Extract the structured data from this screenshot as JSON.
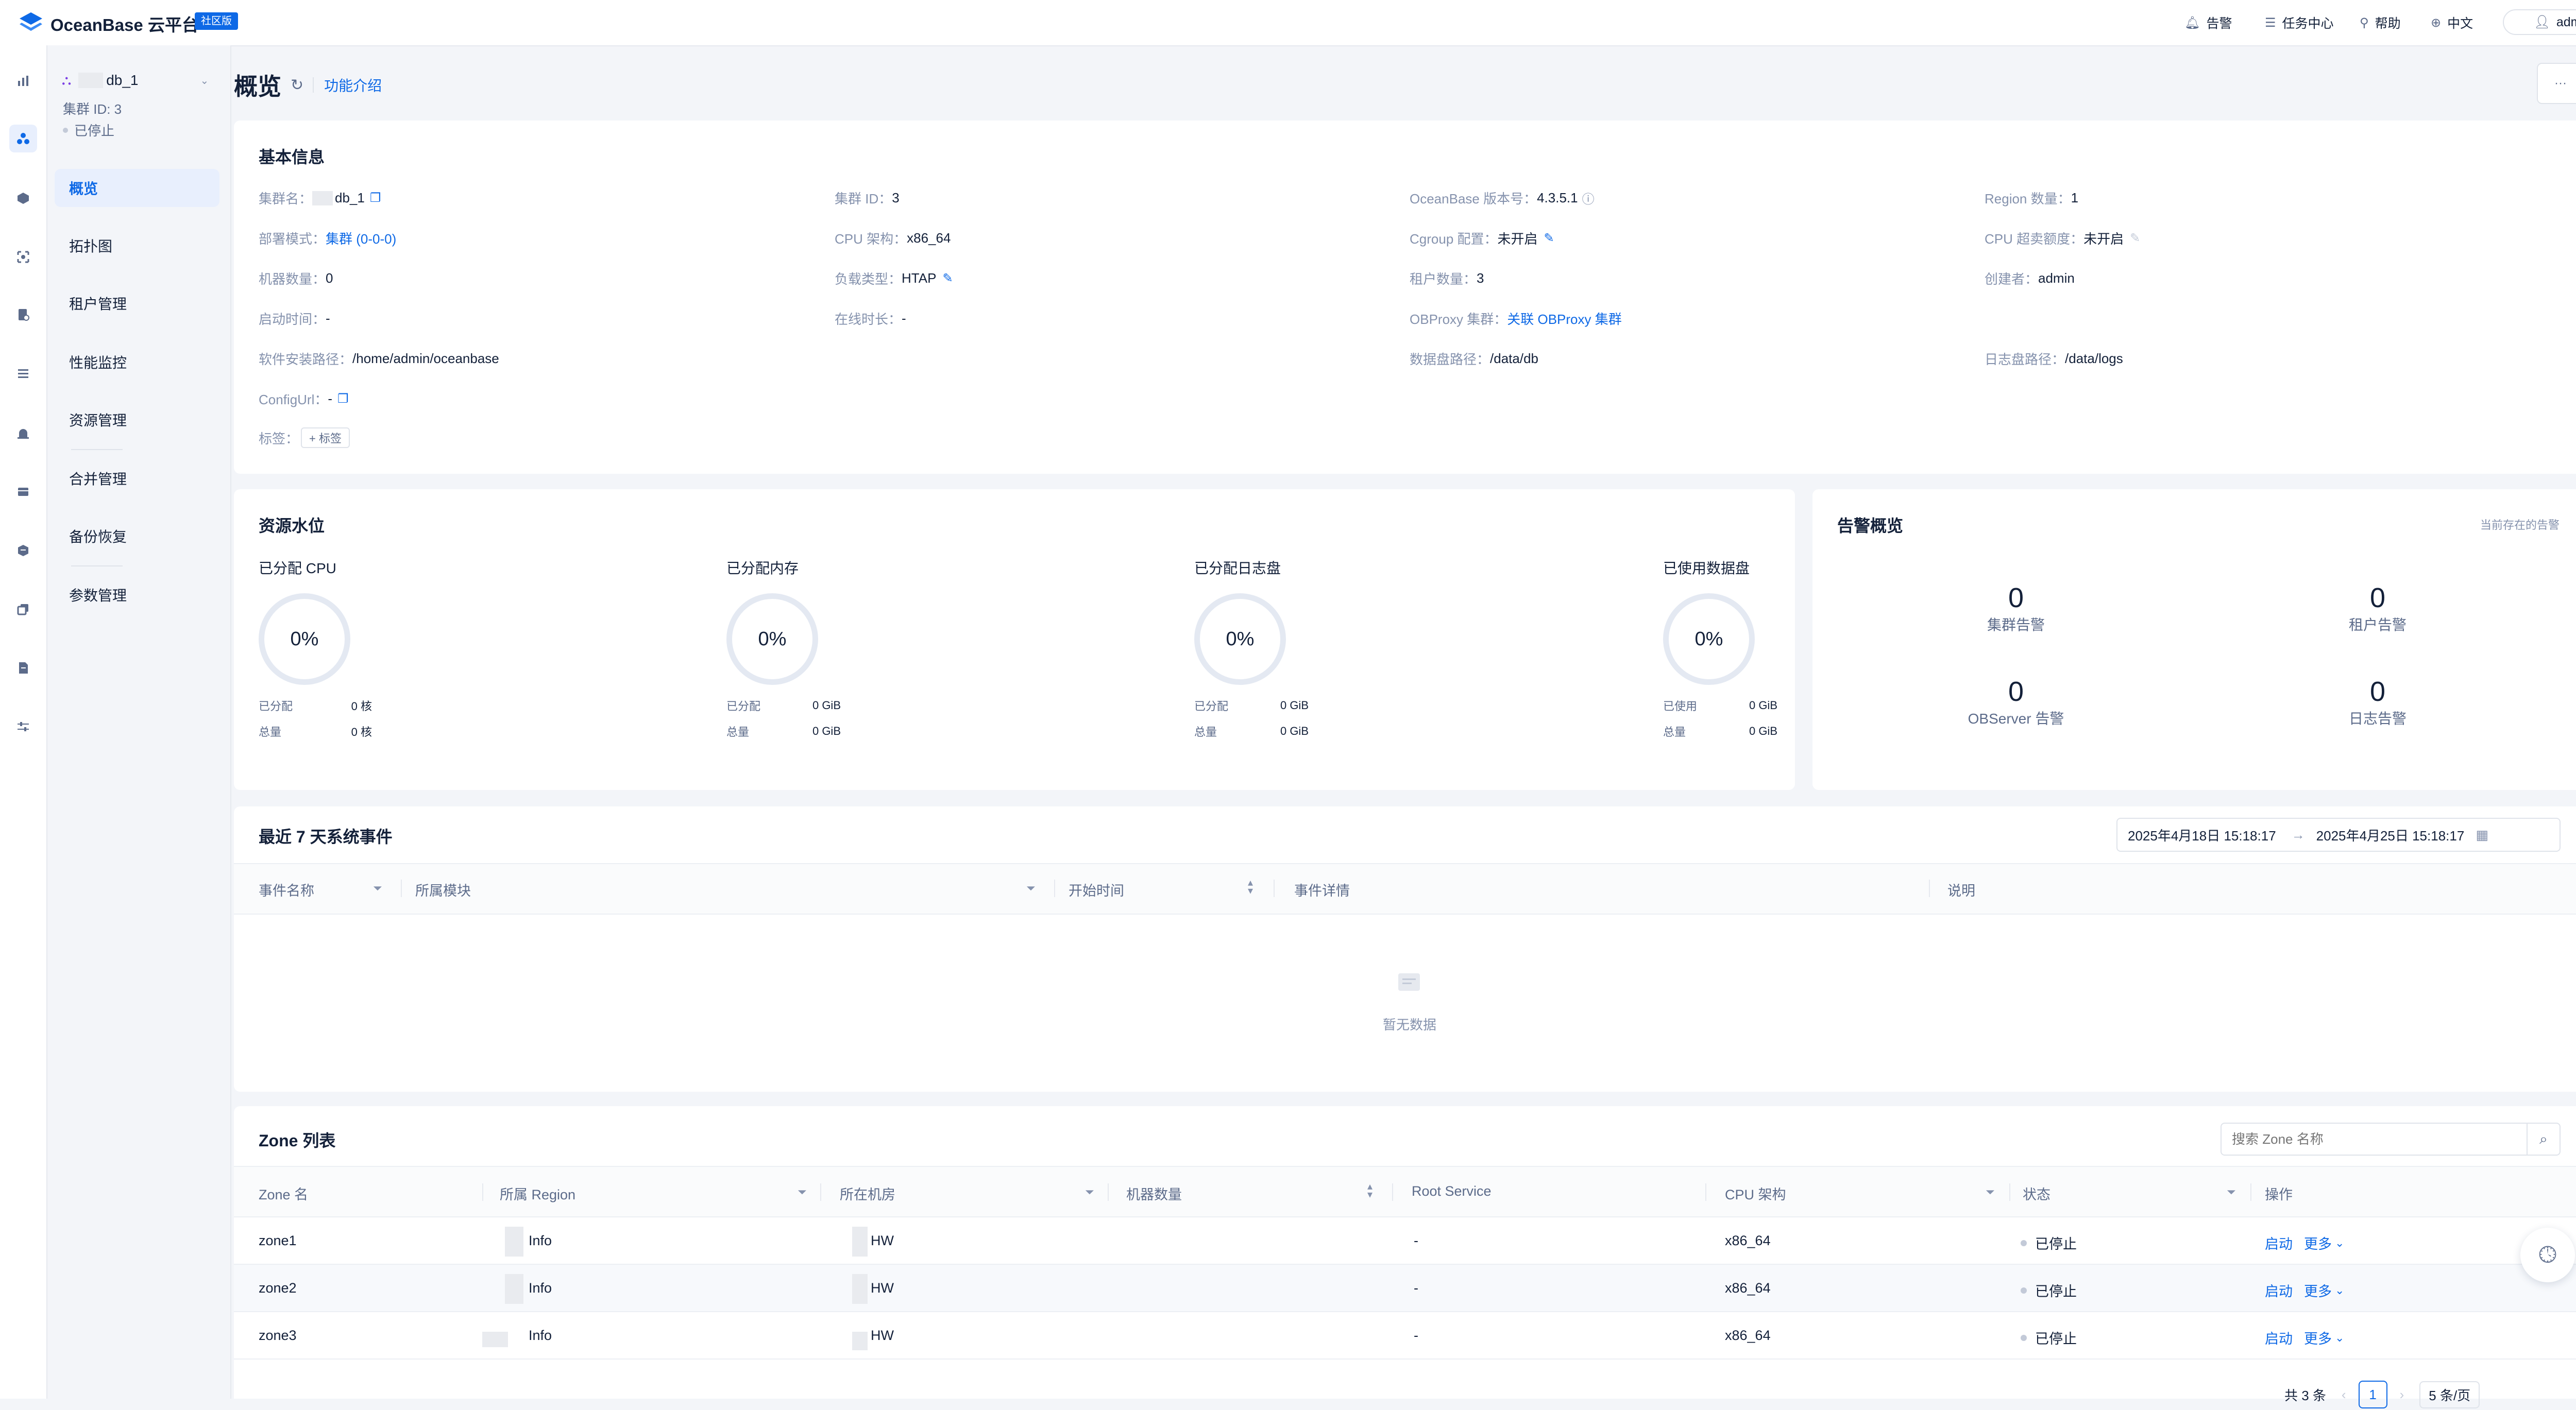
{
  "app": {
    "logo_text": "OceanBase 云平台",
    "edition_badge": "社区版"
  },
  "topbar": {
    "alerts": "告警",
    "tasks": "任务中心",
    "help": "帮助",
    "language": "中文",
    "user": "admin",
    "icons": [
      "bell-icon",
      "list-icon",
      "lightbulb-icon",
      "globe-icon",
      "user-icon"
    ]
  },
  "cluster_panel": {
    "name": "db_1",
    "cluster_id": "集群 ID: 3",
    "status": "已停止"
  },
  "sidenav": {
    "items": [
      "概览",
      "拓扑图",
      "租户管理",
      "性能监控",
      "资源管理",
      "合并管理",
      "备份恢复",
      "参数管理"
    ],
    "active_index": 0
  },
  "page": {
    "title": "概览",
    "feature_intro": "功能介绍",
    "more": "···"
  },
  "basic_info": {
    "title": "基本信息",
    "cluster_name_label": "集群名：",
    "cluster_name_value": "db_1",
    "cluster_id_label": "集群 ID：",
    "cluster_id_value": "3",
    "version_label": "OceanBase 版本号：",
    "version_value": "4.3.5.1",
    "region_count_label": "Region 数量：",
    "region_count_value": "1",
    "deploy_mode_label": "部署模式：",
    "deploy_mode_value": "集群 (0-0-0)",
    "cpu_arch_label": "CPU 架构：",
    "cpu_arch_value": "x86_64",
    "cgroup_label": "Cgroup 配置：",
    "cgroup_value": "未开启",
    "cpu_oversell_label": "CPU 超卖额度：",
    "cpu_oversell_value": "未开启",
    "machine_count_label": "机器数量：",
    "machine_count_value": "0",
    "workload_label": "负载类型：",
    "workload_value": "HTAP",
    "tenant_count_label": "租户数量：",
    "tenant_count_value": "3",
    "creator_label": "创建者：",
    "creator_value": "admin",
    "start_time_label": "启动时间：",
    "start_time_value": "-",
    "online_label": "在线时长：",
    "online_value": "-",
    "obproxy_label": "OBProxy 集群：",
    "obproxy_value": "关联 OBProxy 集群",
    "install_path_label": "软件安装路径：",
    "install_path_value": "/home/admin/oceanbase",
    "data_disk_label": "数据盘路径：",
    "data_disk_value": "/data/db",
    "log_disk_label": "日志盘路径：",
    "log_disk_value": "/data/logs",
    "config_url_label": "ConfigUrl：",
    "config_url_value": "-",
    "tags_label": "标签：",
    "tags_button": "+ 标签"
  },
  "resources": {
    "title": "资源水位",
    "items": [
      {
        "label": "已分配 CPU",
        "percent": "0%",
        "r1_label": "已分配",
        "r1_value": "0 核",
        "r2_label": "总量",
        "r2_value": "0 核"
      },
      {
        "label": "已分配内存",
        "percent": "0%",
        "r1_label": "已分配",
        "r1_value": "0 GiB",
        "r2_label": "总量",
        "r2_value": "0 GiB"
      },
      {
        "label": "已分配日志盘",
        "percent": "0%",
        "r1_label": "已分配",
        "r1_value": "0 GiB",
        "r2_label": "总量",
        "r2_value": "0 GiB"
      },
      {
        "label": "已使用数据盘",
        "percent": "0%",
        "r1_label": "已使用",
        "r1_value": "0 GiB",
        "r2_label": "总量",
        "r2_value": "0 GiB"
      }
    ]
  },
  "alerts_overview": {
    "title": "告警概览",
    "link": "当前存在的告警",
    "items": [
      {
        "count": "0",
        "label": "集群告警"
      },
      {
        "count": "0",
        "label": "租户告警"
      },
      {
        "count": "0",
        "label": "OBServer 告警"
      },
      {
        "count": "0",
        "label": "日志告警"
      }
    ]
  },
  "events": {
    "title": "最近 7 天系统事件",
    "range_start": "2025年4月18日 15:18:17",
    "range_end": "2025年4月25日 15:18:17",
    "columns": [
      "事件名称",
      "所属模块",
      "开始时间",
      "事件详情",
      "说明"
    ],
    "empty_text": "暂无数据"
  },
  "zones": {
    "title": "Zone 列表",
    "search_placeholder": "搜索 Zone 名称",
    "columns": [
      "Zone 名",
      "所属 Region",
      "所在机房",
      "机器数量",
      "Root Service",
      "CPU 架构",
      "状态",
      "操作"
    ],
    "rows": [
      {
        "zone": "zone1",
        "region": "Info",
        "idc": "HW",
        "machines": "",
        "root": "-",
        "arch": "x86_64",
        "status": "已停止",
        "action1": "启动",
        "action2": "更多"
      },
      {
        "zone": "zone2",
        "region": "Info",
        "idc": "HW",
        "machines": "",
        "root": "-",
        "arch": "x86_64",
        "status": "已停止",
        "action1": "启动",
        "action2": "更多"
      },
      {
        "zone": "zone3",
        "region": "Info",
        "idc": "HW",
        "machines": "",
        "root": "-",
        "arch": "x86_64",
        "status": "已停止",
        "action1": "启动",
        "action2": "更多"
      }
    ],
    "pagination_total": "共 3 条",
    "pagination_page": "1",
    "pagination_size": "5 条/页"
  },
  "colors": {
    "primary": "#0e69e6",
    "text": "#132039",
    "muted": "#8592ad",
    "background": "#f3f5f9"
  }
}
